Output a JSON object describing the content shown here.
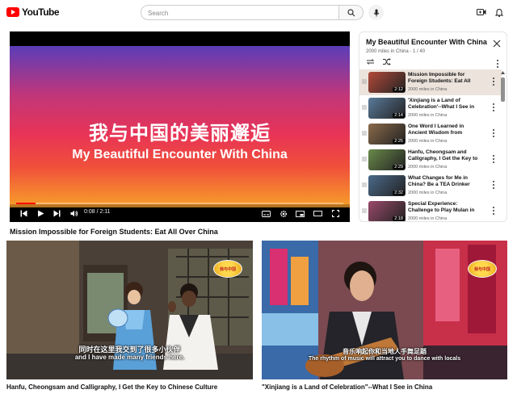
{
  "header": {
    "logo_text": "YouTube",
    "search_placeholder": "Search"
  },
  "player": {
    "frame_text_cn": "我与中国的美丽邂逅",
    "frame_text_en": "My Beautiful Encounter With China",
    "time": "0:08 / 2:11",
    "progress": 0.06,
    "title": "Mission Impossible for Foreign Students: Eat All Over China"
  },
  "playlist": {
    "title": "My Beautiful Encounter With China",
    "subtitle": "2000 miles in China - 1 / 40",
    "items": [
      {
        "title": "Mission Impossible for Foreign Students: Eat All Over China",
        "channel": "2000 miles in China",
        "duration": "2:12",
        "active": true,
        "color": "#b34a3a"
      },
      {
        "title": "'Xinjiang is a Land of Celebration'--What I See in China",
        "channel": "2000 miles in China",
        "duration": "2:14",
        "active": false,
        "color": "#5a7a9a"
      },
      {
        "title": "One Word I Learned in Ancient Wisdom from Chinese Poetry",
        "channel": "2000 miles in China",
        "duration": "2:25",
        "active": false,
        "color": "#8a6a4a"
      },
      {
        "title": "Hanfu, Cheongsam and Calligraphy, I Get the Key to Chinese Culture",
        "channel": "2000 miles in China",
        "duration": "2:29",
        "active": false,
        "color": "#6a8a4a"
      },
      {
        "title": "What Changes for Me in China? Be a TEA Drinker",
        "channel": "2000 miles in China",
        "duration": "2:32",
        "active": false,
        "color": "#4a6a8a"
      },
      {
        "title": "Special Experience: Challenge to Play Mulan in Chinese Opera",
        "channel": "2000 miles in China",
        "duration": "2:18",
        "active": false,
        "color": "#9a4a6a"
      }
    ]
  },
  "cards": [
    {
      "caption_cn": "同时在这里我交到了很多小伙伴",
      "caption_en": "and I have made many friends here.",
      "title": "Hanfu, Cheongsam and Calligraphy, I Get the Key to Chinese Culture"
    },
    {
      "caption_cn": "音乐响起你和当地人手舞足蹈",
      "caption_en": "The rhythm of music will attract you to dance with locals",
      "title": "\"Xinjiang is a Land of Celebration\"--What I See in China"
    }
  ]
}
